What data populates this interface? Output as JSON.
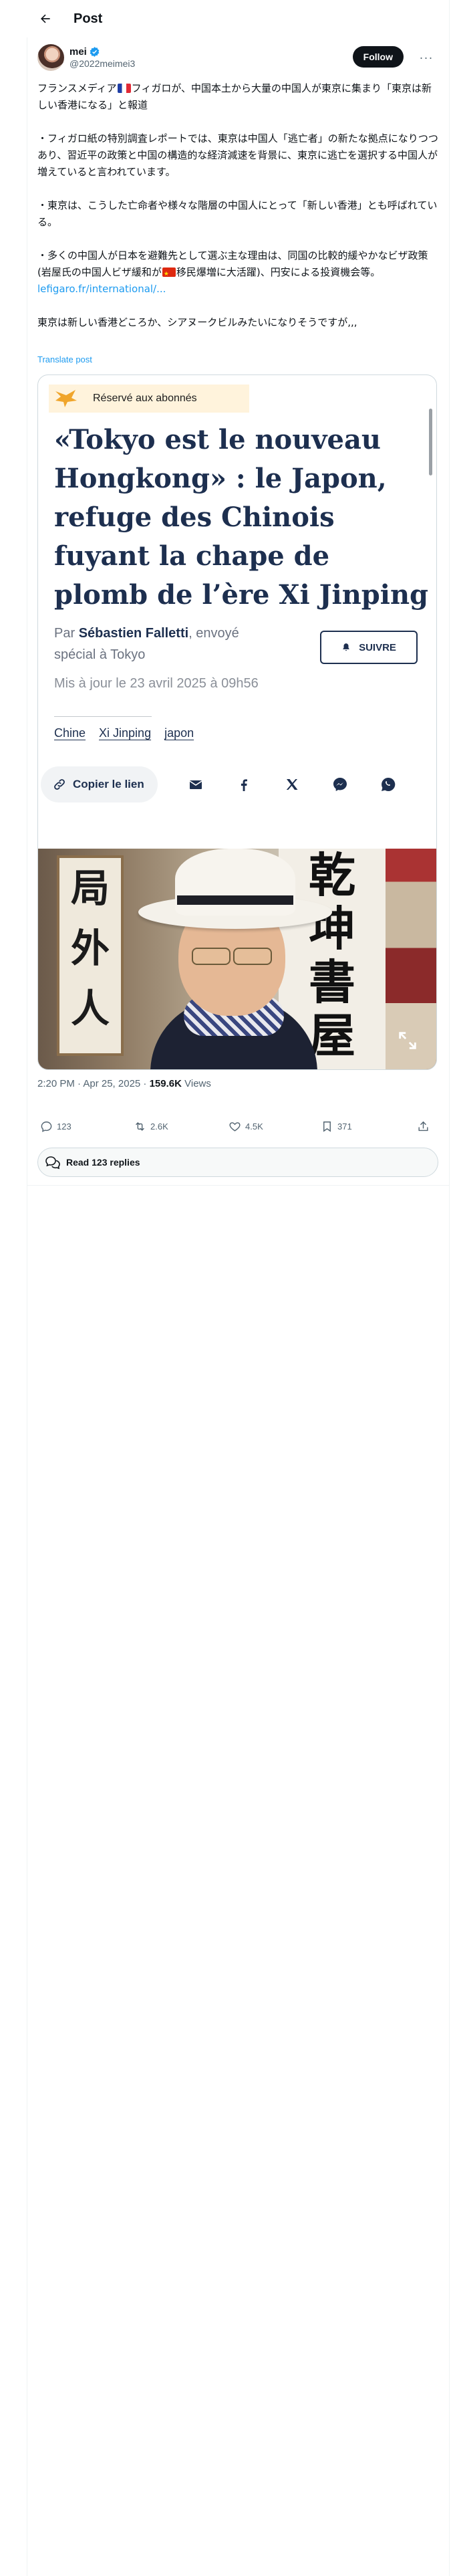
{
  "header": {
    "title": "Post"
  },
  "author": {
    "name": "mei",
    "handle": "@2022meimei3",
    "follow_label": "Follow",
    "more_label": "···"
  },
  "tweet": {
    "p1a": "フランスメディア",
    "p1b": "フィガロが、中国本土から大量の中国人が東京に集まり「東京は新しい香港になる」と報道",
    "p2": "・フィガロ紙の特別調査レポートでは、東京は中国人「逃亡者」の新たな拠点になりつつあり、習近平の政策と中国の構造的な経済減速を背景に、東京に逃亡を選択する中国人が増えていると言われています。",
    "p3": "・東京は、こうした亡命者や様々な階層の中国人にとって「新しい香港」とも呼ばれている。",
    "p4a": "・多くの中国人が日本を避難先として選ぶ主な理由は、同国の比較的緩やかなビザ政策(岩屋氏の中国人ビザ緩和が",
    "p4b": "移民爆増に大活躍)、円安による投資機会等。",
    "link": "lefigaro.fr/international/...",
    "p5": "東京は新しい香港どころか、シアヌークビルみたいになりそうですが,,,",
    "translate_label": "Translate post"
  },
  "article": {
    "badge": "Réservé aux abonnés",
    "title": "«Tokyo est le nouveau Hongkong» : le Japon, refuge des Chinois fuyant la chape de plomb de l’ère Xi Jinping",
    "by_prefix": "Par ",
    "author": "Sébastien Falletti",
    "author_suffix": ", envoyé spécial à Tokyo",
    "follow_label": "SUIVRE",
    "date": "Mis à jour le 23 avril 2025 à 09h56",
    "tags": [
      "Chine",
      "Xi Jinping",
      "japon"
    ],
    "copy_label": "Copier le lien",
    "photo_calligraphy_left": [
      "局",
      "外",
      "人"
    ],
    "photo_calligraphy_right": [
      "乾",
      "坤",
      "書",
      "屋"
    ]
  },
  "meta": {
    "time": "2:20 PM · Apr 25, 2025 · ",
    "views": "159.6K",
    "views_label": " Views"
  },
  "actions": {
    "replies": "123",
    "reposts": "2.6K",
    "likes": "4.5K",
    "bookmarks": "371"
  },
  "read_replies": "Read 123 replies",
  "colors": {
    "accent": "#1d9bf0",
    "article_navy": "#1d2f4f",
    "badge_bg": "#fff3dc"
  },
  "icons": [
    "back-arrow-icon",
    "verified-badge-icon",
    "subscriber-badge-icon",
    "bell-icon",
    "link-icon",
    "mail-icon",
    "facebook-icon",
    "x-icon",
    "messenger-icon",
    "whatsapp-icon",
    "expand-icon",
    "reply-icon",
    "repost-icon",
    "like-icon",
    "bookmark-icon",
    "share-icon",
    "replies-bubble-icon"
  ]
}
